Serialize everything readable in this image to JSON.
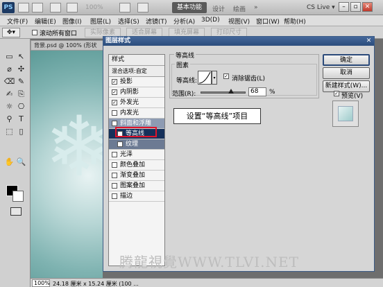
{
  "app": {
    "logo": "PS",
    "zoom": "100%",
    "workspace_active": "基本功能",
    "workspace_links": [
      "设计",
      "绘画",
      "»"
    ],
    "cs_live": "CS Live ▾"
  },
  "menu": [
    "文件(F)",
    "编辑(E)",
    "图像(I)",
    "图层(L)",
    "选择(S)",
    "滤镜(T)",
    "分析(A)",
    "3D(D)",
    "视图(V)",
    "窗口(W)",
    "帮助(H)"
  ],
  "options": {
    "tool_glyph": "✥▾",
    "sample_all_layers": "滚动所有窗口",
    "buttons": [
      "实际像素",
      "适合屏幕",
      "填充屏幕",
      "打印尺寸"
    ]
  },
  "tools": [
    "▭",
    "↖",
    "⌀",
    "✣",
    "⌫",
    "✎",
    "✍",
    "⎘",
    "☼",
    "⎔",
    "⚲",
    "T",
    "⬚",
    "▯",
    "✋",
    "🔍"
  ],
  "document": {
    "tab_title": "背景.psd @ 100% (形状",
    "zoom": "100%",
    "size": "24.18 厘米 x 15.24 厘米 (100 ..."
  },
  "dialog": {
    "title": "图层样式",
    "close": "✕",
    "style_list": {
      "header": "样式",
      "blend_options": "混合选项:自定",
      "items": [
        {
          "label": "投影",
          "checked": true
        },
        {
          "label": "内阴影",
          "checked": true
        },
        {
          "label": "外发光",
          "checked": true
        },
        {
          "label": "内发光",
          "checked": false
        },
        {
          "label": "斜面和浮雕",
          "checked": true
        },
        {
          "label": "等高线",
          "checked": true
        },
        {
          "label": "纹理",
          "checked": false
        },
        {
          "label": "光泽",
          "checked": false
        },
        {
          "label": "颜色叠加",
          "checked": false
        },
        {
          "label": "渐变叠加",
          "checked": false
        },
        {
          "label": "图案叠加",
          "checked": false
        },
        {
          "label": "描边",
          "checked": false
        }
      ]
    },
    "contour": {
      "group_title": "等高线",
      "inner_title": "图素",
      "contour_label": "等高线:",
      "anti_alias": "消除锯齿(L)",
      "range_label": "范围(R):",
      "range_value": "68",
      "range_unit": "%",
      "range_percent": 68
    },
    "buttons": {
      "ok": "确定",
      "cancel": "取消",
      "new_style": "新建样式(W)...",
      "preview": "预览(V)"
    },
    "callout": "设置“等高线”项目"
  },
  "watermark": "腾龍視覺WWW.TLVI.NET",
  "check_mark": "✓"
}
